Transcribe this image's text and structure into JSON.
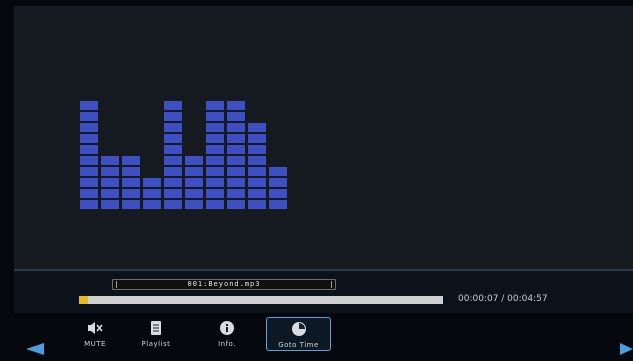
{
  "player": {
    "filename": "001:Beyond.mp3",
    "progress_fraction": 0.025,
    "time_display": "00:00:07 / 00:04:57",
    "equalizer_levels": [
      10,
      5,
      5,
      3,
      10,
      5,
      10,
      10,
      8,
      4
    ]
  },
  "toolbar": {
    "items": [
      {
        "label": "MUTE",
        "icon": "speaker-mute-icon",
        "selected": false
      },
      {
        "label": "Playlist",
        "icon": "playlist-document-icon",
        "selected": false
      },
      {
        "label": "Info.",
        "icon": "info-icon",
        "selected": false
      },
      {
        "label": "Goto Time",
        "icon": "clock-icon",
        "selected": true
      }
    ]
  },
  "colors": {
    "equalizer": "#3d4fc2",
    "progress": "#e8b820",
    "accent": "#4a9ee0",
    "selected_border": "#5fa0d8"
  }
}
